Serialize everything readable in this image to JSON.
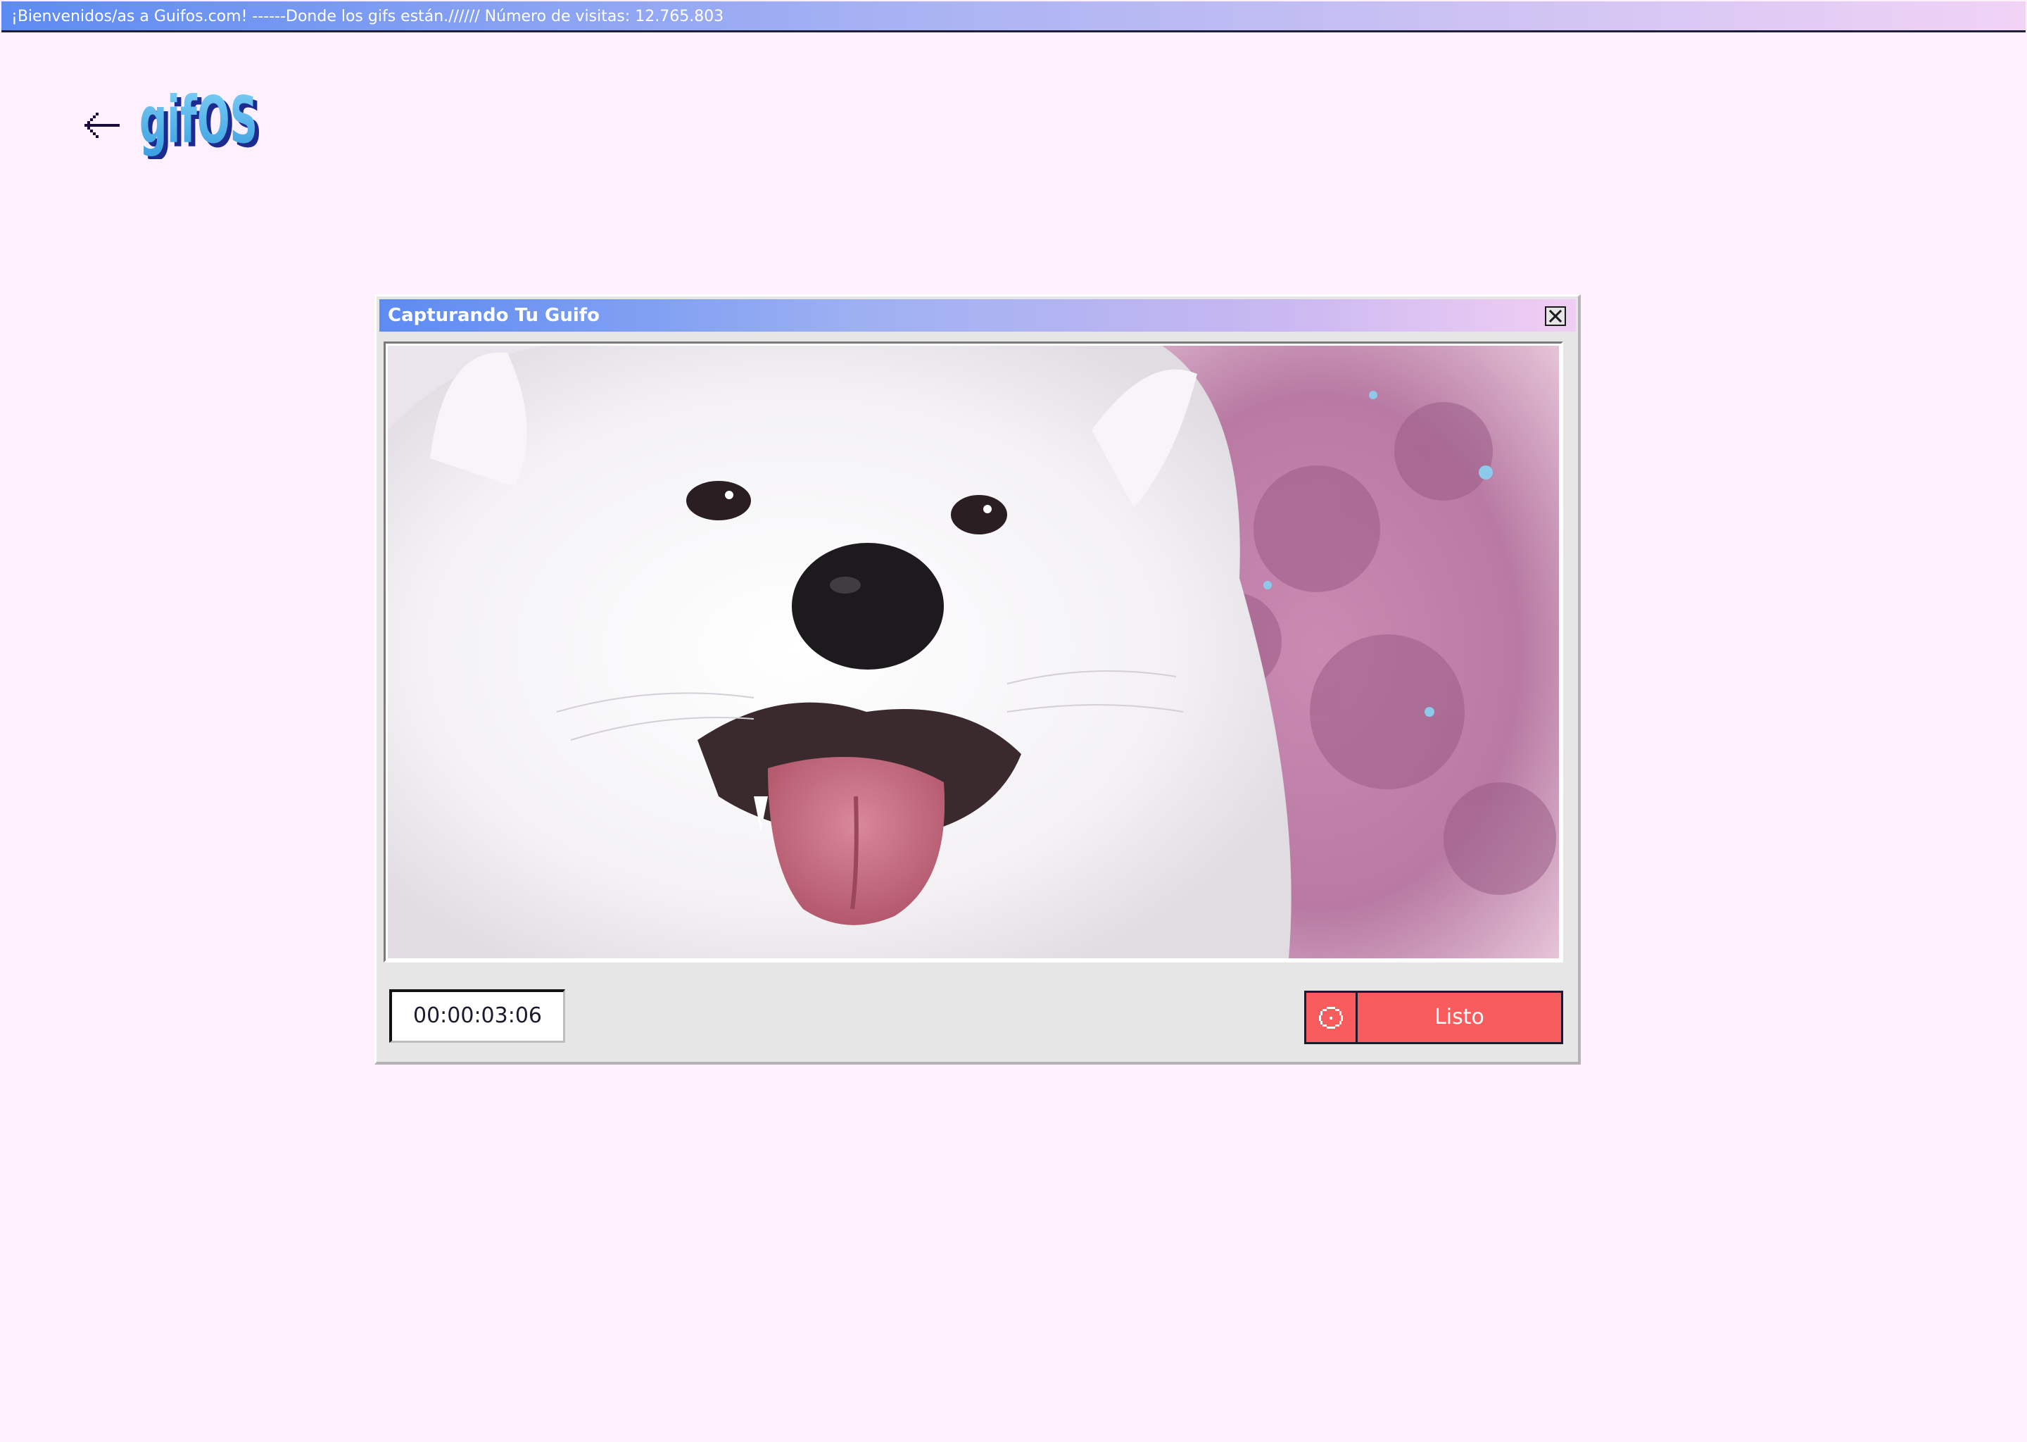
{
  "banner": {
    "text": "¡Bienvenidos/as a Guifos.com! ------Donde los gifs están.////// Número de visitas: 12.765.803"
  },
  "header": {
    "back_icon": "arrow-left-icon",
    "logo_text": "gifOS"
  },
  "capture_window": {
    "title": "Capturando Tu Guifo",
    "close_icon": "close-icon",
    "preview_subject": "video-preview",
    "timer": "00:00:03:06",
    "ready_icon": "recording-icon",
    "ready_label": "Listo"
  },
  "colors": {
    "background": "#fff0fd",
    "gradient_start": "#5d8bf2",
    "gradient_end": "#f1d3f5",
    "window_gray": "#e6e6e6",
    "ready_red": "#f95c5c",
    "dark_ink": "#1b1b2e",
    "logo_blue": "#4fb3ee"
  }
}
